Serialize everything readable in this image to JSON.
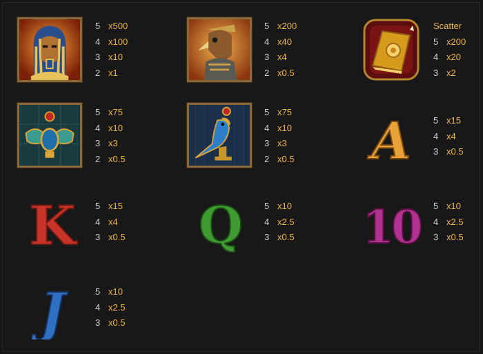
{
  "symbols": [
    {
      "id": "pharaoh",
      "icon": "pharaoh-icon",
      "pays": [
        {
          "n": "5",
          "x": "x500"
        },
        {
          "n": "4",
          "x": "x100"
        },
        {
          "n": "3",
          "x": "x10"
        },
        {
          "n": "2",
          "x": "x1"
        }
      ]
    },
    {
      "id": "horus",
      "icon": "horus-falcon-head-icon",
      "pays": [
        {
          "n": "5",
          "x": "x200"
        },
        {
          "n": "4",
          "x": "x40"
        },
        {
          "n": "3",
          "x": "x4"
        },
        {
          "n": "2",
          "x": "x0.5"
        }
      ]
    },
    {
      "id": "book",
      "title": "Scatter",
      "icon": "book-scatter-icon",
      "pays": [
        {
          "n": "5",
          "x": "x200"
        },
        {
          "n": "4",
          "x": "x20"
        },
        {
          "n": "3",
          "x": "x2"
        }
      ]
    },
    {
      "id": "scarab",
      "icon": "scarab-icon",
      "pays": [
        {
          "n": "5",
          "x": "x75"
        },
        {
          "n": "4",
          "x": "x10"
        },
        {
          "n": "3",
          "x": "x3"
        },
        {
          "n": "2",
          "x": "x0.5"
        }
      ]
    },
    {
      "id": "bird",
      "icon": "falcon-statue-icon",
      "pays": [
        {
          "n": "5",
          "x": "x75"
        },
        {
          "n": "4",
          "x": "x10"
        },
        {
          "n": "3",
          "x": "x3"
        },
        {
          "n": "2",
          "x": "x0.5"
        }
      ]
    },
    {
      "id": "a",
      "letter": "A",
      "color": "#e8a23a",
      "pays": [
        {
          "n": "5",
          "x": "x15"
        },
        {
          "n": "4",
          "x": "x4"
        },
        {
          "n": "3",
          "x": "x0.5"
        }
      ]
    },
    {
      "id": "k",
      "letter": "K",
      "color": "#c8332a",
      "pays": [
        {
          "n": "5",
          "x": "x15"
        },
        {
          "n": "4",
          "x": "x4"
        },
        {
          "n": "3",
          "x": "x0.5"
        }
      ]
    },
    {
      "id": "q",
      "letter": "Q",
      "color": "#3f9a32",
      "pays": [
        {
          "n": "5",
          "x": "x10"
        },
        {
          "n": "4",
          "x": "x2.5"
        },
        {
          "n": "3",
          "x": "x0.5"
        }
      ]
    },
    {
      "id": "ten",
      "letter": "10",
      "color": "#b0348f",
      "pays": [
        {
          "n": "5",
          "x": "x10"
        },
        {
          "n": "4",
          "x": "x2.5"
        },
        {
          "n": "3",
          "x": "x0.5"
        }
      ]
    },
    {
      "id": "j",
      "letter": "J",
      "color": "#2f6fc4",
      "pays": [
        {
          "n": "5",
          "x": "x10"
        },
        {
          "n": "4",
          "x": "x2.5"
        },
        {
          "n": "3",
          "x": "x0.5"
        }
      ]
    }
  ],
  "colors": {
    "multiplier": "#f1b53b",
    "count": "#d0d0d0",
    "background": "#181818",
    "frame": "#8a6a3a"
  }
}
